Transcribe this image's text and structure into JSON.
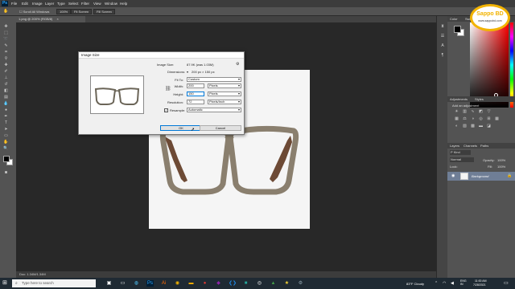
{
  "menubar": {
    "logo": "Ps",
    "items": [
      "File",
      "Edit",
      "Image",
      "Layer",
      "Type",
      "Select",
      "Filter",
      "View",
      "Window",
      "Help"
    ]
  },
  "optionsbar": {
    "buttons": [
      "Scroll All Windows",
      "100%",
      "Fit Screen",
      "Fill Screen"
    ]
  },
  "document": {
    "tab_title": "1.png @ 200% (RGB/8)"
  },
  "statusbar": {
    "text": "Doc: 1.34M/1.34M"
  },
  "panels": {
    "tabs_top": [
      "Color",
      "Swatches"
    ],
    "adjustments_tabs": [
      "Adjustments",
      "Styles"
    ],
    "adjustments_hint": "Add an adjustment",
    "layers_tabs": [
      "Layers",
      "Channels",
      "Paths"
    ],
    "layers_filter": "P Kind",
    "blend_mode": "Normal",
    "opacity_label": "Opacity:",
    "opacity_value": "100%",
    "lock_label": "Lock:",
    "fill_label": "Fill:",
    "fill_value": "100%",
    "layer_name": "Background"
  },
  "dialog": {
    "title": "Image Size",
    "image_size_label": "Image Size:",
    "image_size_value": "87.9K (was 1.03M)",
    "dimensions_label": "Dimensions:",
    "dimensions_value": "200 px  ×  150 px",
    "fit_to_label": "Fit To:",
    "fit_to_value": "Custom",
    "width_label": "Width:",
    "width_value": "200",
    "width_unit": "Pixels",
    "height_label": "Height:",
    "height_value": "150",
    "height_unit": "Pixels",
    "resolution_label": "Resolution:",
    "resolution_value": "72",
    "resolution_unit": "Pixels/Inch",
    "resample_label": "Resample:",
    "resample_checked": true,
    "resample_value": "Automatic",
    "ok_label": "OK",
    "cancel_label": "Cancel"
  },
  "taskbar": {
    "search_placeholder": "Type here to search",
    "weather": "83°F  Cloudy",
    "lang": "ENG\nIN",
    "time": "11:00 AM",
    "date": "7/28/2021"
  },
  "brand": {
    "name": "Sappo BD",
    "url": "www.sappobd.com"
  },
  "colors": {
    "ps_panel": "#535353",
    "ps_dark": "#282828",
    "accent": "#0078d7",
    "brand_yellow": "#f2b300",
    "glasses_frame": "#8a7f6e"
  }
}
